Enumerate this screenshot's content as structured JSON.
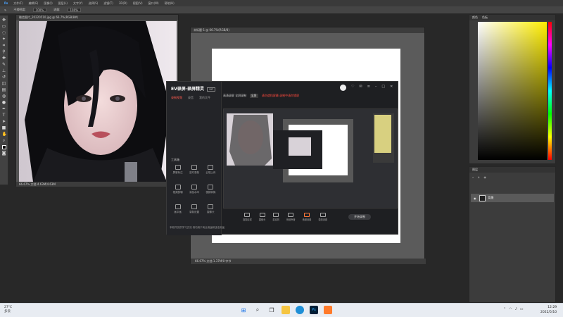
{
  "menubar": {
    "items": [
      "文件(F)",
      "编辑(E)",
      "图像(I)",
      "图层(L)",
      "文字(Y)",
      "选择(S)",
      "滤镜(T)",
      "3D(D)",
      "视图(V)",
      "窗口(W)",
      "帮助(H)"
    ]
  },
  "optionsbar": {
    "opacity_label": "不透明度:",
    "opacity_value": "100%",
    "flow_label": "流量:",
    "flow_value": "100%"
  },
  "doc1": {
    "tab": "微信图片_20220510.jpg @ 66.7%(RGB/8#)",
    "status": "66.67%   文档:4.63M/4.63M"
  },
  "doc2": {
    "tab": "未标题-1 @ 66.7%(RGB/8)",
    "status": "66.67%   文档:1.37M/0 字节"
  },
  "recorder": {
    "app_name": "EV录屏·录屏精灵",
    "version_badge": "VIP",
    "tabs": [
      "录制视频",
      "录音",
      "我的文件"
    ],
    "top_title": "高清录屏 全屏录制",
    "top_badge": "全屏",
    "top_warning": "请勿遮挡屏幕,录制中请勿锁屏",
    "tools_label": "工具箱",
    "tools": [
      {
        "label": "屏幕标注",
        "icon": "annotate-icon"
      },
      {
        "label": "定时录制",
        "icon": "timer-icon"
      },
      {
        "label": "云端上传",
        "icon": "upload-icon"
      },
      {
        "label": "视频剪辑",
        "icon": "cut-icon"
      },
      {
        "label": "添加水印",
        "icon": "watermark-icon"
      },
      {
        "label": "视频转换",
        "icon": "convert-icon"
      },
      {
        "label": "画中画",
        "icon": "pip-icon"
      },
      {
        "label": "录制设置",
        "icon": "settings-icon"
      },
      {
        "label": "摄像头",
        "icon": "camera-icon"
      }
    ],
    "bottom": [
      {
        "label": "选择区域"
      },
      {
        "label": "摄像头"
      },
      {
        "label": "麦克风"
      },
      {
        "label": "系统声音"
      },
      {
        "label": "音频设置"
      },
      {
        "label": "录制设置"
      }
    ],
    "start_label": "开始录制",
    "footnote": "本软件仅供学习交流 请勿用于商业用途和违法用途"
  },
  "rpanel": {
    "tabs": [
      "颜色",
      "色板"
    ]
  },
  "layers": {
    "title": "图层",
    "layer_name": "背景"
  },
  "taskbar": {
    "weather_temp": "27°C",
    "weather_desc": "多云",
    "time": "12:29",
    "date": "2022/5/10"
  },
  "colors": {
    "accent": "#ff5a4e",
    "ps_bg": "#282828",
    "taskbar": "#e8ecf2"
  }
}
